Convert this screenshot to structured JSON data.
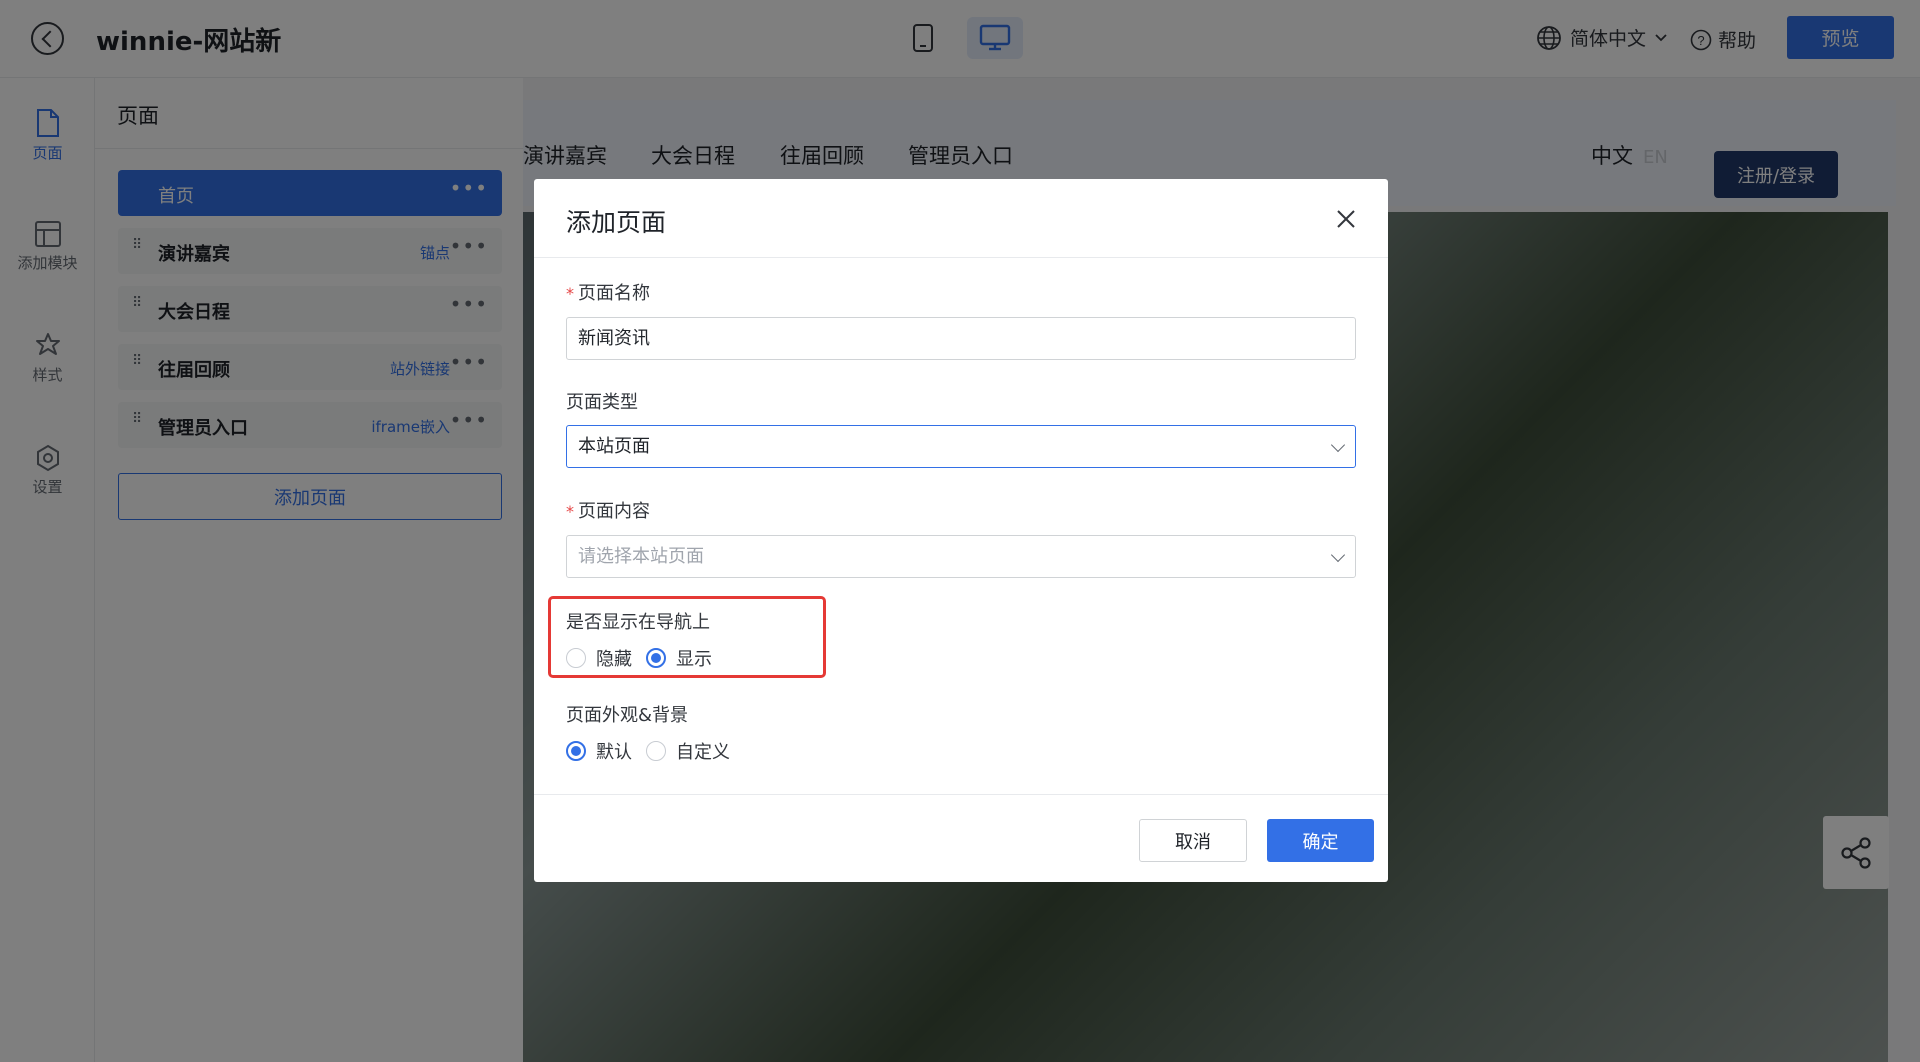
{
  "topbar": {
    "site_title": "winnie-网站新",
    "language": "简体中文",
    "help": "帮助",
    "preview": "预览"
  },
  "rail": {
    "items": [
      {
        "label": "页面",
        "icon": "page-icon"
      },
      {
        "label": "添加模块",
        "icon": "layout-icon"
      },
      {
        "label": "样式",
        "icon": "puzzle-icon"
      },
      {
        "label": "设置",
        "icon": "gear-icon"
      }
    ]
  },
  "panel": {
    "title": "页面",
    "pages": [
      {
        "name": "首页",
        "tag": ""
      },
      {
        "name": "演讲嘉宾",
        "tag": "锚点"
      },
      {
        "name": "大会日程",
        "tag": ""
      },
      {
        "name": "往届回顾",
        "tag": "站外链接"
      },
      {
        "name": "管理员入口",
        "tag": "iframe嵌入"
      }
    ],
    "add_page": "添加页面"
  },
  "site_nav": {
    "items": [
      "演讲嘉宾",
      "大会日程",
      "往届回顾",
      "管理员入口"
    ],
    "lang_cn": "中文",
    "lang_en": "EN",
    "login": "注册/登录"
  },
  "modal": {
    "title": "添加页面",
    "name_label": "页面名称",
    "name_value": "新闻资讯",
    "type_label": "页面类型",
    "type_value": "本站页面",
    "content_label": "页面内容",
    "content_placeholder": "请选择本站页面",
    "nav_label": "是否显示在导航上",
    "nav_options": [
      "隐藏",
      "显示"
    ],
    "nav_selected": "显示",
    "bg_label": "页面外观&背景",
    "bg_options": [
      "默认",
      "自定义"
    ],
    "bg_selected": "默认",
    "cancel": "取消",
    "ok": "确定"
  },
  "colors": {
    "accent": "#3370e6",
    "highlight": "#e53935",
    "login_bg": "#21386b"
  }
}
